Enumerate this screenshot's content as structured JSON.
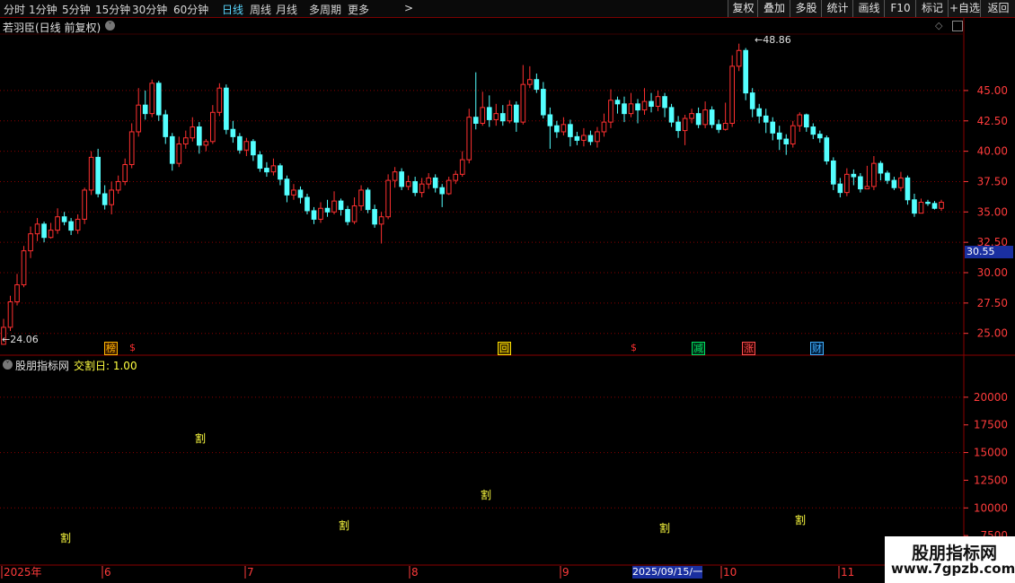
{
  "toolbar": {
    "periods": [
      "分时",
      "1分钟",
      "5分钟",
      "15分钟",
      "30分钟",
      "60分钟",
      "日线",
      "周线",
      "月线",
      "多周期",
      "更多"
    ],
    "active_period": "日线",
    "more_arrow": ">",
    "buttons": [
      "复权",
      "叠加",
      "多股",
      "统计",
      "画线",
      "F10",
      "标记",
      "+自选",
      "返回"
    ]
  },
  "main_chart": {
    "title": "若羽臣(日线 前复权)",
    "high_label": "48.86",
    "low_label": "24.06",
    "current_price": "30.55",
    "y_ticks": [
      "45.00",
      "42.50",
      "40.00",
      "37.50",
      "35.00",
      "32.50",
      "30.00",
      "27.50",
      "25.00"
    ],
    "event_markers": [
      {
        "text": "榜",
        "color": "#ffb400",
        "bg": "#402000"
      },
      {
        "text": "$",
        "color": "#ff3030",
        "bg": "none"
      },
      {
        "text": "回",
        "color": "#ffe000",
        "bg": "#403000"
      },
      {
        "text": "$",
        "color": "#ff3030",
        "bg": "none"
      },
      {
        "text": "减",
        "color": "#00e060",
        "bg": "#003018"
      },
      {
        "text": "涨",
        "color": "#ff5050",
        "bg": "#300000"
      },
      {
        "text": "财",
        "color": "#40b0ff",
        "bg": "#002040"
      }
    ]
  },
  "indicator": {
    "name": "股朋指标网",
    "series_label": "交割日: 1.00",
    "y_ticks": [
      "20000",
      "17500",
      "15000",
      "12500",
      "10000",
      "7500"
    ],
    "marker_char": "割",
    "marker_count": 7
  },
  "x_axis": {
    "labels": [
      "2025年",
      "6",
      "7",
      "8",
      "9",
      "10",
      "11"
    ],
    "cursor_date": "2025/09/15/一"
  },
  "watermark": {
    "title": "股朋指标网",
    "url": "www.7gpzb.com"
  },
  "colors": {
    "up": "#ff3030",
    "down": "#54ffff",
    "grid": "#8a0000",
    "axis_text": "#ff3b3b",
    "active": "#5ad7ff",
    "price_box": "#1a2fa0"
  },
  "chart_data": {
    "type": "candlestick",
    "title": "若羽臣(日线 前复权)",
    "ylim": [
      23.5,
      49.5
    ],
    "candles": [
      [
        24.1,
        25.5,
        26.2,
        24.06
      ],
      [
        25.5,
        27.6,
        28.1,
        25.2
      ],
      [
        27.6,
        29.0,
        29.9,
        27.3
      ],
      [
        29.0,
        31.8,
        32.2,
        28.8
      ],
      [
        31.8,
        33.2,
        33.8,
        31.2
      ],
      [
        33.2,
        34.0,
        34.5,
        32.6
      ],
      [
        34.0,
        32.9,
        34.2,
        32.5
      ],
      [
        32.9,
        33.5,
        34.1,
        32.8
      ],
      [
        33.5,
        34.6,
        35.3,
        33.2
      ],
      [
        34.6,
        34.2,
        35.0,
        33.9
      ],
      [
        34.2,
        33.5,
        34.5,
        33.1
      ],
      [
        33.5,
        34.4,
        34.8,
        33.2
      ],
      [
        34.4,
        36.8,
        37.0,
        34.0
      ],
      [
        36.8,
        39.5,
        40.0,
        36.4
      ],
      [
        39.5,
        36.5,
        40.2,
        36.2
      ],
      [
        36.5,
        35.6,
        37.2,
        35.2
      ],
      [
        35.6,
        36.8,
        37.5,
        34.8
      ],
      [
        36.8,
        37.5,
        38.0,
        36.5
      ],
      [
        37.5,
        38.9,
        39.4,
        37.2
      ],
      [
        38.9,
        41.6,
        42.3,
        38.6
      ],
      [
        41.6,
        43.8,
        45.2,
        41.2
      ],
      [
        43.8,
        43.1,
        45.0,
        42.6
      ],
      [
        43.1,
        45.6,
        45.9,
        42.8
      ],
      [
        45.6,
        43.0,
        45.8,
        42.5
      ],
      [
        43.0,
        41.2,
        43.4,
        40.6
      ],
      [
        41.2,
        39.0,
        41.5,
        38.4
      ],
      [
        39.0,
        40.6,
        41.2,
        38.7
      ],
      [
        40.6,
        41.1,
        41.7,
        40.2
      ],
      [
        41.1,
        42.0,
        42.8,
        40.8
      ],
      [
        42.0,
        40.5,
        42.4,
        39.8
      ],
      [
        40.5,
        40.8,
        41.0,
        40.0
      ],
      [
        40.8,
        43.2,
        43.8,
        40.6
      ],
      [
        43.2,
        45.2,
        45.6,
        42.9
      ],
      [
        45.2,
        41.8,
        45.5,
        41.4
      ],
      [
        41.8,
        41.2,
        42.5,
        40.7
      ],
      [
        41.2,
        40.1,
        41.5,
        39.8
      ],
      [
        40.1,
        40.8,
        41.1,
        39.6
      ],
      [
        40.8,
        39.7,
        41.0,
        39.2
      ],
      [
        39.7,
        38.6,
        40.0,
        38.3
      ],
      [
        38.6,
        38.3,
        39.1,
        37.9
      ],
      [
        38.3,
        38.8,
        39.4,
        38.0
      ],
      [
        38.8,
        37.7,
        39.0,
        37.2
      ],
      [
        37.7,
        36.4,
        38.0,
        35.8
      ],
      [
        36.4,
        36.8,
        37.3,
        36.0
      ],
      [
        36.8,
        36.2,
        37.1,
        35.7
      ],
      [
        36.2,
        35.1,
        36.5,
        34.8
      ],
      [
        35.1,
        34.4,
        35.4,
        34.0
      ],
      [
        34.4,
        35.3,
        35.8,
        34.1
      ],
      [
        35.3,
        35.0,
        36.0,
        34.6
      ],
      [
        35.0,
        35.9,
        36.7,
        34.8
      ],
      [
        35.9,
        35.2,
        36.1,
        34.7
      ],
      [
        35.2,
        34.2,
        35.5,
        33.9
      ],
      [
        34.2,
        35.5,
        36.2,
        34.0
      ],
      [
        35.5,
        36.8,
        37.2,
        35.1
      ],
      [
        36.8,
        35.2,
        37.0,
        34.9
      ],
      [
        35.2,
        34.0,
        35.6,
        33.7
      ],
      [
        34.0,
        34.6,
        35.0,
        32.4
      ],
      [
        34.6,
        37.6,
        38.1,
        34.4
      ],
      [
        37.6,
        38.3,
        38.7,
        37.0
      ],
      [
        38.3,
        37.1,
        38.6,
        36.8
      ],
      [
        37.1,
        37.5,
        38.0,
        36.8
      ],
      [
        37.5,
        36.6,
        37.9,
        36.3
      ],
      [
        36.6,
        37.3,
        37.8,
        36.2
      ],
      [
        37.3,
        37.8,
        38.2,
        36.9
      ],
      [
        37.8,
        37.0,
        38.1,
        36.6
      ],
      [
        37.0,
        36.5,
        37.3,
        35.4
      ],
      [
        36.5,
        37.6,
        37.9,
        36.4
      ],
      [
        37.6,
        38.1,
        38.4,
        37.3
      ],
      [
        38.1,
        39.3,
        40.0,
        37.9
      ],
      [
        39.3,
        42.8,
        43.5,
        39.0
      ],
      [
        42.8,
        42.3,
        46.5,
        41.8
      ],
      [
        42.3,
        43.6,
        44.9,
        42.1
      ],
      [
        43.6,
        42.6,
        44.6,
        42.0
      ],
      [
        42.6,
        43.1,
        43.9,
        42.1
      ],
      [
        43.1,
        42.5,
        43.8,
        42.1
      ],
      [
        42.5,
        43.8,
        44.2,
        42.3
      ],
      [
        43.8,
        42.4,
        44.1,
        41.6
      ],
      [
        42.4,
        45.5,
        47.1,
        42.2
      ],
      [
        45.5,
        45.9,
        47.0,
        45.2
      ],
      [
        45.9,
        45.1,
        46.4,
        44.8
      ],
      [
        45.1,
        43.0,
        45.7,
        42.7
      ],
      [
        43.0,
        42.1,
        43.6,
        40.2
      ],
      [
        42.1,
        41.6,
        42.5,
        41.1
      ],
      [
        41.6,
        42.2,
        42.8,
        41.3
      ],
      [
        42.2,
        41.2,
        42.6,
        40.4
      ],
      [
        41.2,
        40.9,
        41.6,
        40.5
      ],
      [
        40.9,
        41.3,
        41.9,
        40.4
      ],
      [
        41.3,
        40.8,
        41.7,
        40.5
      ],
      [
        40.8,
        41.6,
        42.0,
        40.3
      ],
      [
        41.6,
        42.4,
        43.1,
        41.2
      ],
      [
        42.4,
        44.2,
        45.1,
        41.9
      ],
      [
        44.2,
        43.9,
        44.5,
        43.1
      ],
      [
        43.9,
        43.1,
        44.5,
        42.4
      ],
      [
        43.1,
        43.9,
        44.8,
        42.8
      ],
      [
        43.9,
        43.4,
        44.3,
        42.3
      ],
      [
        43.4,
        44.1,
        45.2,
        43.0
      ],
      [
        44.1,
        43.7,
        44.8,
        43.2
      ],
      [
        43.7,
        44.5,
        45.0,
        43.3
      ],
      [
        44.5,
        43.6,
        44.8,
        42.8
      ],
      [
        43.6,
        42.4,
        43.9,
        42.0
      ],
      [
        42.4,
        41.7,
        42.9,
        41.1
      ],
      [
        41.7,
        42.7,
        43.0,
        40.5
      ],
      [
        42.7,
        43.1,
        43.5,
        42.3
      ],
      [
        43.1,
        42.2,
        43.6,
        41.9
      ],
      [
        42.2,
        43.4,
        44.1,
        41.9
      ],
      [
        43.4,
        42.2,
        43.7,
        41.9
      ],
      [
        42.2,
        41.8,
        42.6,
        41.5
      ],
      [
        41.8,
        42.3,
        44.0,
        41.7
      ],
      [
        42.3,
        47.0,
        47.9,
        42.0
      ],
      [
        47.0,
        48.3,
        48.86,
        46.6
      ],
      [
        48.3,
        44.8,
        48.5,
        44.2
      ],
      [
        44.8,
        43.5,
        45.2,
        42.8
      ],
      [
        43.5,
        42.9,
        43.9,
        42.3
      ],
      [
        42.9,
        42.4,
        43.5,
        41.5
      ],
      [
        42.4,
        41.5,
        42.8,
        40.9
      ],
      [
        41.5,
        41.0,
        42.1,
        40.1
      ],
      [
        41.0,
        40.6,
        41.4,
        39.7
      ],
      [
        40.6,
        42.1,
        42.5,
        40.3
      ],
      [
        42.1,
        43.0,
        43.2,
        41.6
      ],
      [
        43.0,
        42.0,
        43.1,
        41.6
      ],
      [
        42.0,
        41.4,
        42.3,
        41.0
      ],
      [
        41.4,
        41.1,
        41.7,
        40.7
      ],
      [
        41.1,
        39.2,
        41.3,
        38.9
      ],
      [
        39.2,
        37.3,
        39.5,
        36.8
      ],
      [
        37.3,
        36.6,
        37.8,
        36.2
      ],
      [
        36.6,
        38.1,
        38.6,
        36.3
      ],
      [
        38.1,
        37.9,
        38.5,
        37.2
      ],
      [
        37.9,
        36.9,
        38.2,
        36.6
      ],
      [
        36.9,
        37.1,
        38.8,
        36.9
      ],
      [
        37.1,
        39.0,
        39.6,
        36.8
      ],
      [
        39.0,
        38.2,
        39.2,
        37.6
      ],
      [
        38.2,
        37.6,
        38.4,
        37.3
      ],
      [
        37.6,
        37.0,
        37.9,
        36.8
      ],
      [
        37.0,
        37.8,
        38.3,
        36.7
      ],
      [
        37.8,
        36.0,
        38.0,
        35.6
      ],
      [
        36.0,
        34.9,
        36.5,
        34.6
      ],
      [
        34.9,
        35.8,
        36.1,
        34.9
      ],
      [
        35.8,
        35.7,
        36.0,
        35.5
      ],
      [
        35.7,
        35.3,
        35.9,
        35.2
      ],
      [
        35.3,
        35.8,
        36.0,
        35.1
      ]
    ],
    "indicator_values": [
      {
        "x": 0.06,
        "v": 5200
      },
      {
        "x": 0.19,
        "v": 15000
      },
      {
        "x": 0.34,
        "v": 6300
      },
      {
        "x": 0.48,
        "v": 10000
      },
      {
        "x": 0.65,
        "v": 6000
      },
      {
        "x": 0.79,
        "v": 6700
      }
    ],
    "indicator_ylim": [
      5000,
      22500
    ]
  }
}
